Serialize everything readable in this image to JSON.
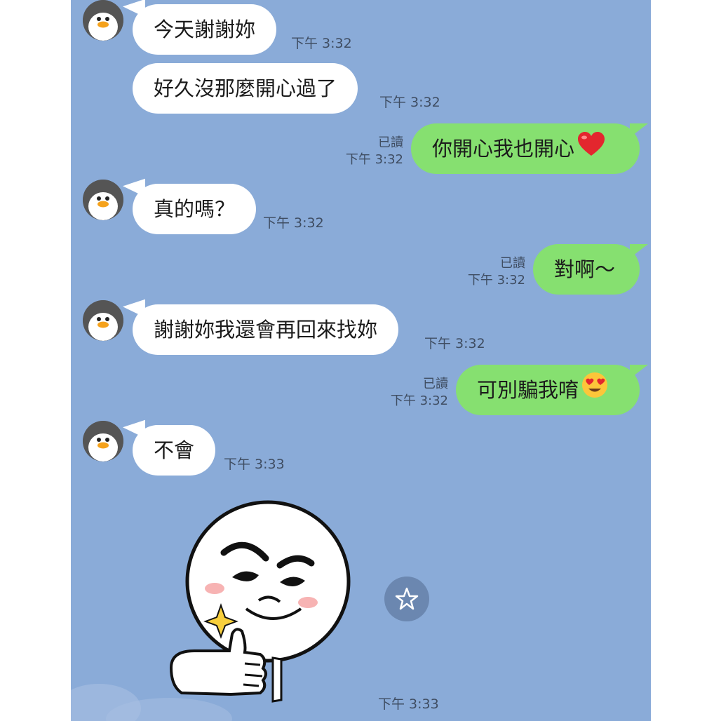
{
  "messages": [
    {
      "side": "in",
      "text": "今天謝謝妳",
      "time": "下午 3:32"
    },
    {
      "side": "in",
      "text": "好久沒那麼開心過了",
      "time": "下午 3:32"
    },
    {
      "side": "out",
      "text": "你開心我也開心",
      "emoji": "heart-emoji",
      "read": "已讀",
      "time": "下午 3:32"
    },
    {
      "side": "in",
      "text": "真的嗎？",
      "time": "下午 3:32"
    },
    {
      "side": "out",
      "text": "對啊～",
      "read": "已讀",
      "time": "下午 3:32"
    },
    {
      "side": "in",
      "text": "謝謝妳我還會再回來找妳",
      "time": "下午 3:32"
    },
    {
      "side": "out",
      "text": "可別騙我唷",
      "emoji": "heart-eyes-emoji",
      "read": "已讀",
      "time": "下午 3:32"
    },
    {
      "side": "in",
      "text": "不會",
      "time": "下午 3:33"
    }
  ],
  "sticker": {
    "icon": "thumbs-up-face-sticker",
    "time": "下午 3:33"
  },
  "favorite_icon": "star-icon",
  "colors": {
    "background": "#8aabd8",
    "incoming_bubble": "#ffffff",
    "outgoing_bubble": "#86e070",
    "timestamp": "#3f4d62"
  }
}
